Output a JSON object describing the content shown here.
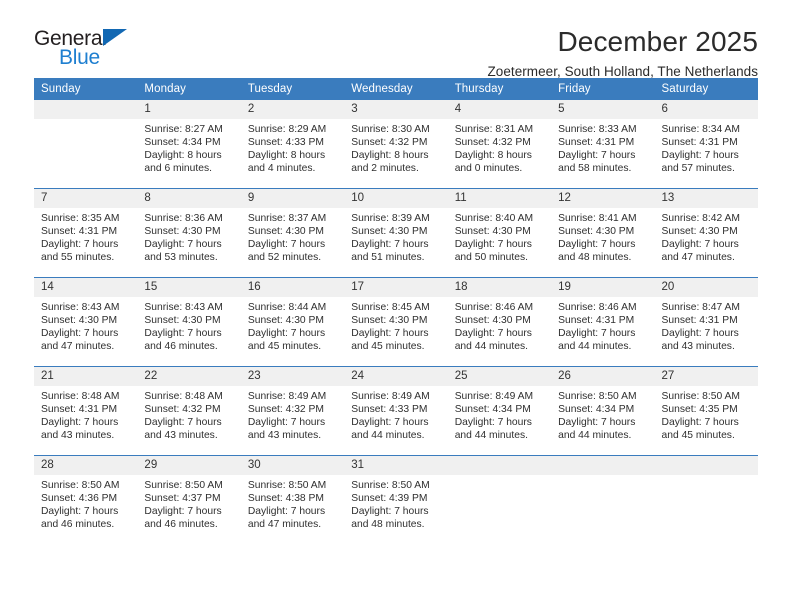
{
  "logo": {
    "word1": "General",
    "word2": "Blue",
    "triangle_color": "#1268b3",
    "blue_color": "#1f7fd0"
  },
  "header": {
    "month_title": "December 2025",
    "location": "Zoetermeer, South Holland, The Netherlands"
  },
  "calendar": {
    "header_color": "#3a7cbe",
    "daynum_band_color": "#f0f0f0",
    "weekday_headers": [
      "Sunday",
      "Monday",
      "Tuesday",
      "Wednesday",
      "Thursday",
      "Friday",
      "Saturday"
    ],
    "weeks": [
      [
        {
          "day": "",
          "empty": true
        },
        {
          "day": "1",
          "sunrise": "Sunrise: 8:27 AM",
          "sunset": "Sunset: 4:34 PM",
          "daylight": "Daylight: 8 hours and 6 minutes."
        },
        {
          "day": "2",
          "sunrise": "Sunrise: 8:29 AM",
          "sunset": "Sunset: 4:33 PM",
          "daylight": "Daylight: 8 hours and 4 minutes."
        },
        {
          "day": "3",
          "sunrise": "Sunrise: 8:30 AM",
          "sunset": "Sunset: 4:32 PM",
          "daylight": "Daylight: 8 hours and 2 minutes."
        },
        {
          "day": "4",
          "sunrise": "Sunrise: 8:31 AM",
          "sunset": "Sunset: 4:32 PM",
          "daylight": "Daylight: 8 hours and 0 minutes."
        },
        {
          "day": "5",
          "sunrise": "Sunrise: 8:33 AM",
          "sunset": "Sunset: 4:31 PM",
          "daylight": "Daylight: 7 hours and 58 minutes."
        },
        {
          "day": "6",
          "sunrise": "Sunrise: 8:34 AM",
          "sunset": "Sunset: 4:31 PM",
          "daylight": "Daylight: 7 hours and 57 minutes."
        }
      ],
      [
        {
          "day": "7",
          "sunrise": "Sunrise: 8:35 AM",
          "sunset": "Sunset: 4:31 PM",
          "daylight": "Daylight: 7 hours and 55 minutes."
        },
        {
          "day": "8",
          "sunrise": "Sunrise: 8:36 AM",
          "sunset": "Sunset: 4:30 PM",
          "daylight": "Daylight: 7 hours and 53 minutes."
        },
        {
          "day": "9",
          "sunrise": "Sunrise: 8:37 AM",
          "sunset": "Sunset: 4:30 PM",
          "daylight": "Daylight: 7 hours and 52 minutes."
        },
        {
          "day": "10",
          "sunrise": "Sunrise: 8:39 AM",
          "sunset": "Sunset: 4:30 PM",
          "daylight": "Daylight: 7 hours and 51 minutes."
        },
        {
          "day": "11",
          "sunrise": "Sunrise: 8:40 AM",
          "sunset": "Sunset: 4:30 PM",
          "daylight": "Daylight: 7 hours and 50 minutes."
        },
        {
          "day": "12",
          "sunrise": "Sunrise: 8:41 AM",
          "sunset": "Sunset: 4:30 PM",
          "daylight": "Daylight: 7 hours and 48 minutes."
        },
        {
          "day": "13",
          "sunrise": "Sunrise: 8:42 AM",
          "sunset": "Sunset: 4:30 PM",
          "daylight": "Daylight: 7 hours and 47 minutes."
        }
      ],
      [
        {
          "day": "14",
          "sunrise": "Sunrise: 8:43 AM",
          "sunset": "Sunset: 4:30 PM",
          "daylight": "Daylight: 7 hours and 47 minutes."
        },
        {
          "day": "15",
          "sunrise": "Sunrise: 8:43 AM",
          "sunset": "Sunset: 4:30 PM",
          "daylight": "Daylight: 7 hours and 46 minutes."
        },
        {
          "day": "16",
          "sunrise": "Sunrise: 8:44 AM",
          "sunset": "Sunset: 4:30 PM",
          "daylight": "Daylight: 7 hours and 45 minutes."
        },
        {
          "day": "17",
          "sunrise": "Sunrise: 8:45 AM",
          "sunset": "Sunset: 4:30 PM",
          "daylight": "Daylight: 7 hours and 45 minutes."
        },
        {
          "day": "18",
          "sunrise": "Sunrise: 8:46 AM",
          "sunset": "Sunset: 4:30 PM",
          "daylight": "Daylight: 7 hours and 44 minutes."
        },
        {
          "day": "19",
          "sunrise": "Sunrise: 8:46 AM",
          "sunset": "Sunset: 4:31 PM",
          "daylight": "Daylight: 7 hours and 44 minutes."
        },
        {
          "day": "20",
          "sunrise": "Sunrise: 8:47 AM",
          "sunset": "Sunset: 4:31 PM",
          "daylight": "Daylight: 7 hours and 43 minutes."
        }
      ],
      [
        {
          "day": "21",
          "sunrise": "Sunrise: 8:48 AM",
          "sunset": "Sunset: 4:31 PM",
          "daylight": "Daylight: 7 hours and 43 minutes."
        },
        {
          "day": "22",
          "sunrise": "Sunrise: 8:48 AM",
          "sunset": "Sunset: 4:32 PM",
          "daylight": "Daylight: 7 hours and 43 minutes."
        },
        {
          "day": "23",
          "sunrise": "Sunrise: 8:49 AM",
          "sunset": "Sunset: 4:32 PM",
          "daylight": "Daylight: 7 hours and 43 minutes."
        },
        {
          "day": "24",
          "sunrise": "Sunrise: 8:49 AM",
          "sunset": "Sunset: 4:33 PM",
          "daylight": "Daylight: 7 hours and 44 minutes."
        },
        {
          "day": "25",
          "sunrise": "Sunrise: 8:49 AM",
          "sunset": "Sunset: 4:34 PM",
          "daylight": "Daylight: 7 hours and 44 minutes."
        },
        {
          "day": "26",
          "sunrise": "Sunrise: 8:50 AM",
          "sunset": "Sunset: 4:34 PM",
          "daylight": "Daylight: 7 hours and 44 minutes."
        },
        {
          "day": "27",
          "sunrise": "Sunrise: 8:50 AM",
          "sunset": "Sunset: 4:35 PM",
          "daylight": "Daylight: 7 hours and 45 minutes."
        }
      ],
      [
        {
          "day": "28",
          "sunrise": "Sunrise: 8:50 AM",
          "sunset": "Sunset: 4:36 PM",
          "daylight": "Daylight: 7 hours and 46 minutes."
        },
        {
          "day": "29",
          "sunrise": "Sunrise: 8:50 AM",
          "sunset": "Sunset: 4:37 PM",
          "daylight": "Daylight: 7 hours and 46 minutes."
        },
        {
          "day": "30",
          "sunrise": "Sunrise: 8:50 AM",
          "sunset": "Sunset: 4:38 PM",
          "daylight": "Daylight: 7 hours and 47 minutes."
        },
        {
          "day": "31",
          "sunrise": "Sunrise: 8:50 AM",
          "sunset": "Sunset: 4:39 PM",
          "daylight": "Daylight: 7 hours and 48 minutes."
        },
        {
          "day": "",
          "empty": true
        },
        {
          "day": "",
          "empty": true
        },
        {
          "day": "",
          "empty": true
        }
      ]
    ]
  }
}
